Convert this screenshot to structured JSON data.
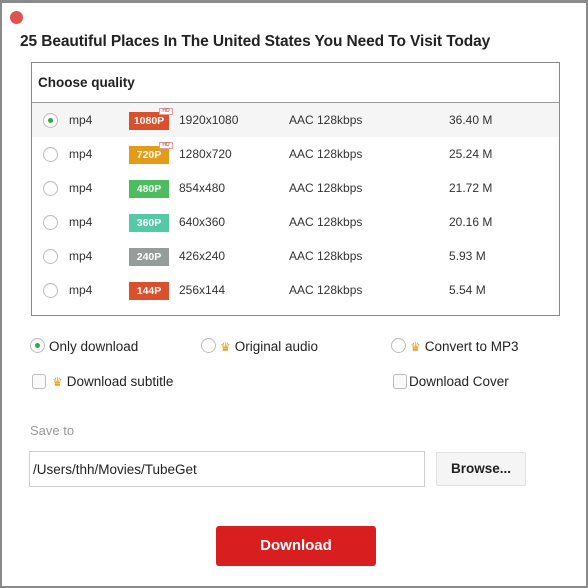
{
  "window": {
    "title": "25 Beautiful Places In The United States You Need To Visit Today",
    "close_color": "#e0524d"
  },
  "quality": {
    "header": "Choose quality",
    "selected_index": 0,
    "rows": [
      {
        "format": "mp4",
        "badge": "1080P",
        "badge_color": "#d9502c",
        "hd": true,
        "hd_label": "HD",
        "resolution": "1920x1080",
        "audio": "AAC 128kbps",
        "size": "36.40 M"
      },
      {
        "format": "mp4",
        "badge": "720P",
        "badge_color": "#e39b19",
        "hd": true,
        "hd_label": "HD",
        "resolution": "1280x720",
        "audio": "AAC 128kbps",
        "size": "25.24 M"
      },
      {
        "format": "mp4",
        "badge": "480P",
        "badge_color": "#4cbd5e",
        "hd": false,
        "resolution": "854x480",
        "audio": "AAC 128kbps",
        "size": "21.72 M"
      },
      {
        "format": "mp4",
        "badge": "360P",
        "badge_color": "#55c9a5",
        "hd": false,
        "resolution": "640x360",
        "audio": "AAC 128kbps",
        "size": "20.16 M"
      },
      {
        "format": "mp4",
        "badge": "240P",
        "badge_color": "#959c9a",
        "hd": false,
        "resolution": "426x240",
        "audio": "AAC 128kbps",
        "size": "5.93 M"
      },
      {
        "format": "mp4",
        "badge": "144P",
        "badge_color": "#d9502c",
        "hd": false,
        "resolution": "256x144",
        "audio": "AAC 128kbps",
        "size": "5.54 M"
      }
    ]
  },
  "options": {
    "only_download": {
      "label": "Only download",
      "checked": true
    },
    "original_audio": {
      "label": "Original audio",
      "checked": false,
      "premium_icon": "crown-icon"
    },
    "convert_mp3": {
      "label": "Convert to MP3",
      "checked": false,
      "premium_icon": "crown-icon"
    },
    "download_subtitle": {
      "label": "Download subtitle",
      "checked": false,
      "premium_icon": "crown-icon"
    },
    "download_cover": {
      "label": "Download Cover",
      "checked": false
    }
  },
  "save": {
    "label": "Save to",
    "path": "/Users/thh/Movies/TubeGet",
    "browse_label": "Browse..."
  },
  "download_button": {
    "label": "Download",
    "color": "#d81e1e"
  }
}
